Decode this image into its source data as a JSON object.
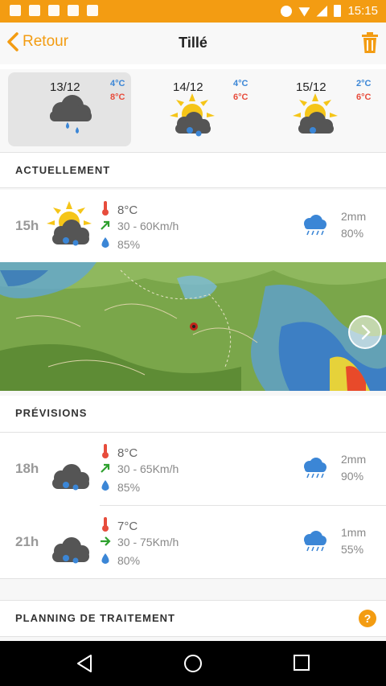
{
  "status_bar": {
    "time": "15:15"
  },
  "header": {
    "back_label": "Retour",
    "title": "Tillé"
  },
  "days": [
    {
      "date": "13/12",
      "min": "4°C",
      "max": "8°C",
      "icon": "cloud-rain-icon",
      "selected": true
    },
    {
      "date": "14/12",
      "min": "4°C",
      "max": "6°C",
      "icon": "sun-cloud-rain-icon",
      "selected": false
    },
    {
      "date": "15/12",
      "min": "2°C",
      "max": "6°C",
      "icon": "sun-cloud-rain-icon",
      "selected": false
    }
  ],
  "current": {
    "title": "ACTUELLEMENT",
    "hour": "15h",
    "icon": "sun-cloud-rain-icon",
    "temp": "8°C",
    "wind": "30 - 60Km/h",
    "humidity": "85%",
    "rain": "2mm",
    "rain_prob": "80%"
  },
  "forecast": {
    "title": "PRÉVISIONS",
    "rows": [
      {
        "hour": "18h",
        "icon": "moon-cloud-rain-icon",
        "temp": "8°C",
        "wind": "30 - 65Km/h",
        "humidity": "85%",
        "rain": "2mm",
        "rain_prob": "90%"
      },
      {
        "hour": "21h",
        "icon": "moon-cloud-rain-icon",
        "temp": "7°C",
        "wind": "30 - 75Km/h",
        "humidity": "80%",
        "rain": "1mm",
        "rain_prob": "55%"
      }
    ]
  },
  "planning": {
    "title": "PLANNING DE TRAITEMENT"
  },
  "colors": {
    "accent": "#f39c12",
    "min_temp": "#3b86d6",
    "max_temp": "#e74c3c",
    "rain_blue": "#3b86d6"
  }
}
